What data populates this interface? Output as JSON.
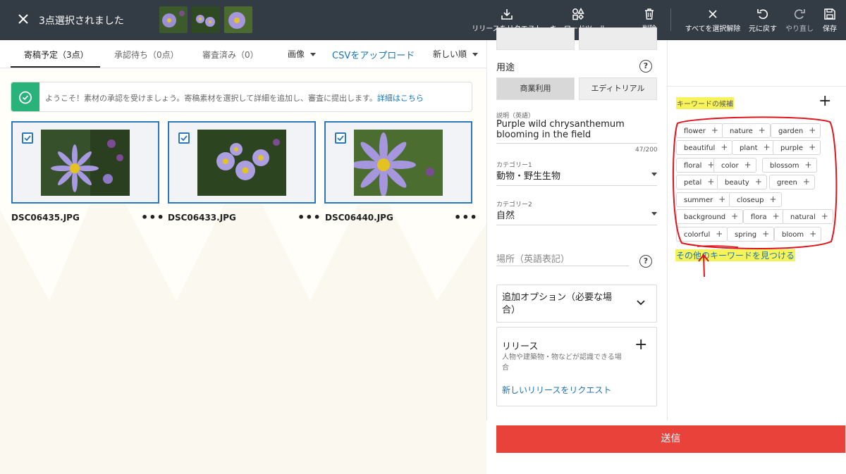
{
  "topbar": {
    "title": "3点選択されました",
    "tools": {
      "request_release": "リリースをリクエスト",
      "keyword_tool": "キーワードツール",
      "delete": "削除",
      "deselect_all": "すべてを選択解除",
      "undo": "元に戻す",
      "redo": "やり直し",
      "save": "保存"
    }
  },
  "tabs": {
    "scheduled": "寄稿予定（3点）",
    "pending": "承認待ち（0点）",
    "reviewed": "審査済み（0）",
    "media_filter": "画像",
    "csv_upload": "CSVをアップロード",
    "sort": "新しい順"
  },
  "banner": {
    "text": "ようこそ！素材の承認を受けましょう。寄稿素材を選択して詳細を追加し、審査に提出します。",
    "link": "詳細はこちら"
  },
  "files": [
    {
      "name": "DSC06435.JPG",
      "more": "•••"
    },
    {
      "name": "DSC06433.JPG",
      "more": "•••"
    },
    {
      "name": "DSC06440.JPG",
      "more": "•••"
    }
  ],
  "details": {
    "usage_label": "用途",
    "usage_commercial": "商業利用",
    "usage_editorial": "エディトリアル",
    "description_label": "説明（英語）",
    "description_value": "Purple wild chrysanthemum blooming in the field",
    "description_count": "47/200",
    "category1_label": "カテゴリー1",
    "category1_value": "動物・野生生物",
    "category2_label": "カテゴリー2",
    "category2_value": "自然",
    "location_placeholder": "場所（英語表記）",
    "help": "?",
    "additional_options": "追加オプション（必要な場合）",
    "release_title": "リリース",
    "release_desc": "人物や建築物・物などが認識できる場合",
    "release_link": "新しいリリースをリクエスト",
    "release_plus": "+"
  },
  "keywords": {
    "title": "キーワードの候補",
    "add": "+",
    "items": [
      "flower",
      "nature",
      "garden",
      "beautiful",
      "plant",
      "purple",
      "floral",
      "color",
      "blossom",
      "petal",
      "beauty",
      "green",
      "summer",
      "closeup",
      "background",
      "flora",
      "natural",
      "colorful",
      "spring",
      "bloom"
    ],
    "plus": "+",
    "find_more": "その他のキーワードを見つける",
    "annotation_color": "#e0141c",
    "highlight_color": "#f7f35a"
  },
  "submit": "送信"
}
